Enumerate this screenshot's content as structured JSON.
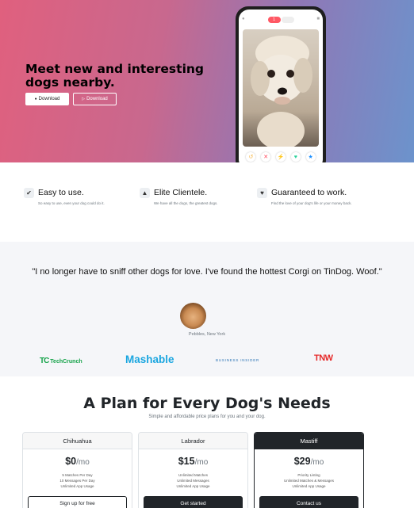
{
  "hero": {
    "title": "Meet new and interesting dogs nearby.",
    "download_apple": "Download",
    "download_google": "Download",
    "app_bar_badge": "1"
  },
  "features": [
    {
      "icon": "check-circle-icon",
      "title": "Easy to use.",
      "desc": "So easy to use, even your dog could do it."
    },
    {
      "icon": "graduation-cap-icon",
      "title": "Elite Clientele.",
      "desc": "We have all the dogs, the greatest dogs."
    },
    {
      "icon": "heart-icon",
      "title": "Guaranteed to work.",
      "desc": "Find the love of your dog's life or your money back."
    }
  ],
  "testimonial": {
    "quote": "\"I no longer have to sniff other dogs for love. I've found the hottest Corgi on TinDog. Woof.\"",
    "author": "Pebbles, New York"
  },
  "press": {
    "techcrunch": "TechCrunch",
    "mashable": "Mashable",
    "business_insider": "BUSINESS INSIDER",
    "tnw": "TNW"
  },
  "pricing": {
    "title": "A Plan for Every Dog's Needs",
    "subtitle": "Simple and affordable price plans for you and your dog.",
    "plans": [
      {
        "name": "Chihuahua",
        "price": "$0",
        "period": "/mo",
        "lines": [
          "5 Matches Per Day",
          "10 Messages Per Day",
          "Unlimited App Usage"
        ],
        "cta": "Sign up for free"
      },
      {
        "name": "Labrador",
        "price": "$15",
        "period": "/mo",
        "lines": [
          "Unlimited Matches",
          "Unlimited Messages",
          "Unlimited App Usage"
        ],
        "cta": "Get started"
      },
      {
        "name": "Mastiff",
        "price": "$29",
        "period": "/mo",
        "lines": [
          "Priority Listing",
          "Unlimited Matches & Messages",
          "Unlimited App Usage"
        ],
        "cta": "Contact us"
      }
    ]
  },
  "colors": {
    "gradient_start": "#e0607e",
    "gradient_end": "#6c93cc",
    "brand_dark": "#212529",
    "techcrunch": "#16a34a",
    "mashable": "#1aa6e0",
    "tnw": "#e62a2a"
  }
}
